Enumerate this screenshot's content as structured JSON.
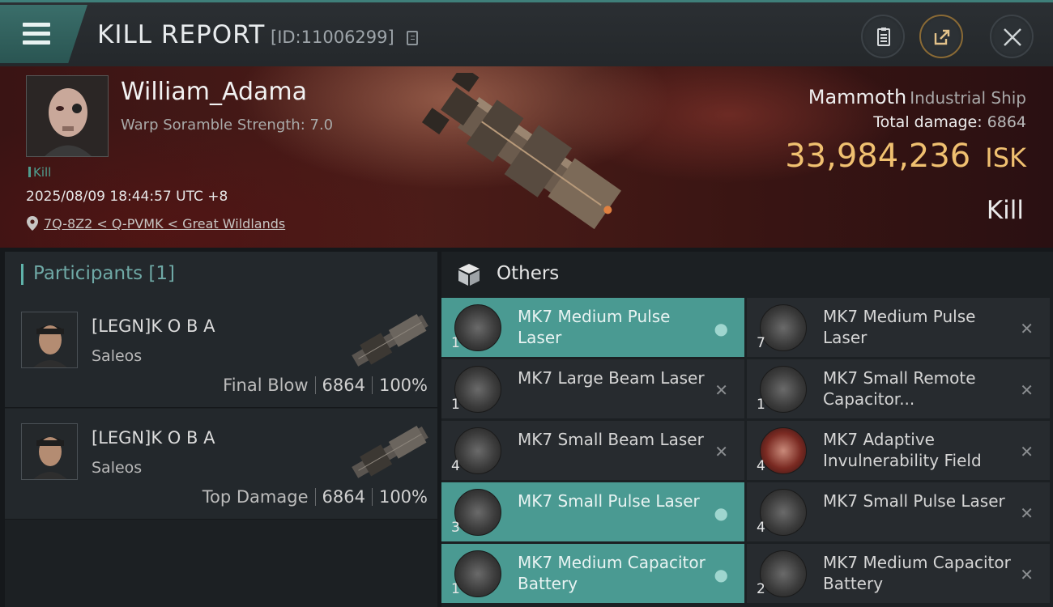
{
  "header": {
    "title": "KILL REPORT",
    "report_id": "[ID:11006299]",
    "icons": [
      "menu-icon",
      "copy-icon",
      "notes-icon",
      "share-icon",
      "close-icon"
    ]
  },
  "victim": {
    "name": "William_Adama",
    "warp_scramble": "Warp Soramble Strength: 7.0",
    "tag": "Kill",
    "timestamp": "2025/08/09 18:44:57 UTC +8",
    "location": "7Q-8Z2 < Q-PVMK < Great Wildlands"
  },
  "ship": {
    "name": "Mammoth",
    "class": "Industrial Ship",
    "total_damage_label": "Total damage:",
    "total_damage": "6864",
    "isk_value": "33,984,236",
    "isk_unit": "ISK",
    "result": "Kill"
  },
  "participants": {
    "title": "Participants [1]",
    "rows": [
      {
        "name": "[LEGN]K O B A",
        "ship": "Saleos",
        "label": "Final Blow",
        "damage": "6864",
        "percent": "100%"
      },
      {
        "name": "[LEGN]K O B A",
        "ship": "Saleos",
        "label": "Top Damage",
        "damage": "6864",
        "percent": "100%"
      }
    ]
  },
  "others": {
    "title": "Others",
    "items": [
      {
        "qty": "1",
        "name": "MK7 Medium Pulse Laser",
        "status": "dropped"
      },
      {
        "qty": "7",
        "name": "MK7 Medium Pulse Laser",
        "status": "destroyed"
      },
      {
        "qty": "1",
        "name": "MK7 Large Beam Laser",
        "status": "destroyed"
      },
      {
        "qty": "1",
        "name": "MK7 Small Remote Capacitor...",
        "status": "destroyed"
      },
      {
        "qty": "4",
        "name": "MK7 Small Beam Laser",
        "status": "destroyed"
      },
      {
        "qty": "4",
        "name": "MK7 Adaptive Invulnerability Field",
        "status": "destroyed"
      },
      {
        "qty": "3",
        "name": "MK7 Small Pulse Laser",
        "status": "dropped"
      },
      {
        "qty": "4",
        "name": "MK7 Small Pulse Laser",
        "status": "destroyed"
      },
      {
        "qty": "1",
        "name": "MK7 Medium Capacitor Battery",
        "status": "dropped"
      },
      {
        "qty": "2",
        "name": "MK7 Medium Capacitor Battery",
        "status": "destroyed"
      }
    ]
  },
  "colors": {
    "accent": "#4a9a92",
    "isk": "#f0c070",
    "hero": "#4b1c18"
  }
}
